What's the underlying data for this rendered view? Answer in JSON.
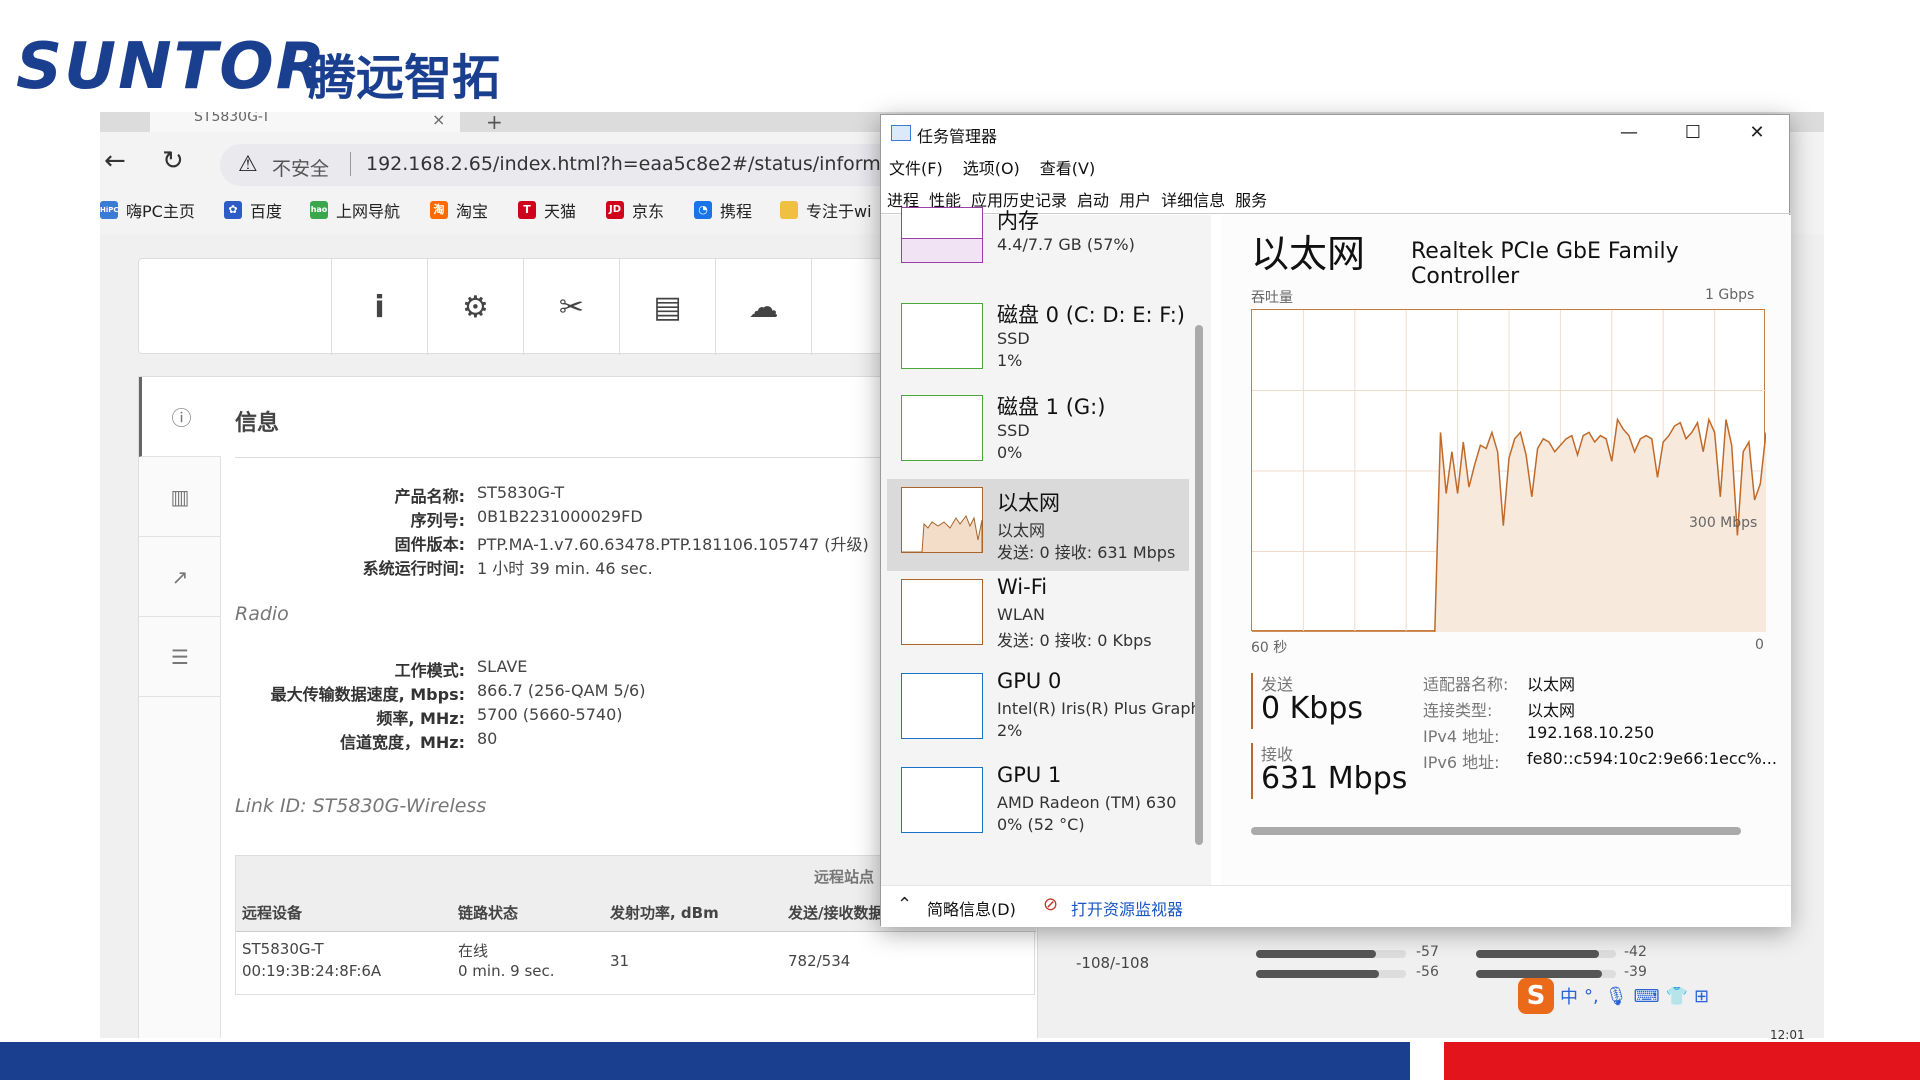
{
  "logo": {
    "latin": "SUNTOR",
    "cn": "腾远智拓"
  },
  "browser": {
    "tab_title": "ST5830G-T",
    "tab_close": "×",
    "new_tab": "+",
    "insecure_label": "不安全",
    "url": "192.168.2.65/index.html?h=eaa5c8e2#/status/information",
    "bookmarks": [
      {
        "icon_text": "HiPC",
        "label": "嗨PC主页",
        "color": "#3a7bd5"
      },
      {
        "icon_text": "",
        "label": "百度",
        "color": "#2d5cc8"
      },
      {
        "icon_text": "hao",
        "label": "上网导航",
        "color": "#3aa84a"
      },
      {
        "icon_text": "淘",
        "label": "淘宝",
        "color": "#ff6a00"
      },
      {
        "icon_text": "T",
        "label": "天猫",
        "color": "#d0021b"
      },
      {
        "icon_text": "JD",
        "label": "京东",
        "color": "#d0021b"
      },
      {
        "icon_text": "",
        "label": "携程",
        "color": "#1a73e8"
      },
      {
        "icon_text": "",
        "label": "专注于wi",
        "color": "#f0c040"
      }
    ]
  },
  "webpage": {
    "info_title": "信息",
    "product": [
      {
        "k": "产品名称:",
        "v": "ST5830G-T"
      },
      {
        "k": "序列号:",
        "v": "0B1B2231000029FD"
      },
      {
        "k": "固件版本:",
        "v": "PTP.MA-1.v7.60.63478.PTP.181106.105747 (升级)"
      },
      {
        "k": "系统运行时间:",
        "v": "1 小时 39 min. 46 sec."
      }
    ],
    "radio_heading": "Radio",
    "radio": [
      {
        "k": "工作模式:",
        "v": "SLAVE"
      },
      {
        "k": "最大传输数据速度, Mbps:",
        "v": "866.7 (256-QAM 5/6)"
      },
      {
        "k": "频率, MHz:",
        "v": "5700 (5660-5740)"
      },
      {
        "k": "信道宽度，MHz:",
        "v": "80"
      }
    ],
    "link_id": "Link ID: ST5830G-Wireless",
    "table": {
      "group_header": "远程站点",
      "headers": [
        "远程设备",
        "链路状态",
        "发射功率, dBm",
        "发送/接收数据"
      ],
      "row": {
        "device": "ST5830G-T",
        "mac": "00:19:3B:24:8F:6A",
        "status": "在线",
        "status_time": "0 min. 9 sec.",
        "tx_power": "31",
        "txrx": "782/534",
        "signal": "-108/-108"
      },
      "bars": [
        {
          "value": -57,
          "label": "-57",
          "fill": 0.8
        },
        {
          "value": -56,
          "label": "-56",
          "fill": 0.82
        },
        {
          "value": -42,
          "label": "-42",
          "fill": 0.88
        },
        {
          "value": -39,
          "label": "-39",
          "fill": 0.9
        }
      ]
    }
  },
  "taskmgr": {
    "title": "任务管理器",
    "menu": [
      "文件(F)",
      "选项(O)",
      "查看(V)"
    ],
    "tabs": [
      "进程",
      "性能",
      "应用历史记录",
      "启动",
      "用户",
      "详细信息",
      "服务"
    ],
    "resources": [
      {
        "name": "内存",
        "l1": "4.4/7.7 GB (57%)",
        "l2": "",
        "color": "#9a3fa8"
      },
      {
        "name": "磁盘 0 (C: D: E: F:)",
        "l1": "SSD",
        "l2": "1%",
        "color": "#4aa83a"
      },
      {
        "name": "磁盘 1 (G:)",
        "l1": "SSD",
        "l2": "0%",
        "color": "#4aa83a"
      },
      {
        "name": "以太网",
        "l1": "以太网",
        "l2": "发送: 0 接收: 631 Mbps",
        "color": "#a8642a"
      },
      {
        "name": "Wi-Fi",
        "l1": "WLAN",
        "l2": "发送: 0 接收: 0 Kbps",
        "color": "#a8642a"
      },
      {
        "name": "GPU 0",
        "l1": "Intel(R) Iris(R) Plus Graph",
        "l2": "2%",
        "color": "#1a73c8"
      },
      {
        "name": "GPU 1",
        "l1": "AMD Radeon (TM) 630",
        "l2": "0% (52 °C)",
        "color": "#1a73c8"
      }
    ],
    "eth_title": "以太网",
    "eth_device": "Realtek PCIe GbE Family Controller",
    "throughput_label": "吞吐量",
    "y_max_label": "1 Gbps",
    "mid_label": "300 Mbps",
    "x_left_label": "60 秒",
    "x_right_label": "0",
    "send_label": "发送",
    "send_value": "0 Kbps",
    "recv_label": "接收",
    "recv_value": "631 Mbps",
    "details": [
      {
        "k": "适配器名称:",
        "v": "以太网"
      },
      {
        "k": "连接类型:",
        "v": "以太网"
      },
      {
        "k": "IPv4 地址:",
        "v": "192.168.10.250"
      },
      {
        "k": "IPv6 地址:",
        "v": "fe80::c594:10c2:9e66:1ecc%..."
      }
    ],
    "footer_brief": "简略信息(D)",
    "footer_monitor": "打开资源监视器"
  },
  "chart_data": {
    "type": "area",
    "title": "",
    "xlabel": "",
    "ylabel": "吞吐量",
    "x_range_label": "60 秒",
    "ylim": [
      0,
      1000
    ],
    "y_unit": "Mbps",
    "series": [
      {
        "values": [
          0,
          0,
          0,
          0,
          0,
          0,
          0,
          0,
          0,
          0,
          0,
          0,
          0,
          0,
          0,
          0,
          0,
          0,
          0,
          0,
          0,
          0,
          0,
          0,
          0,
          0,
          0,
          0,
          0,
          0,
          0,
          0,
          0,
          620,
          430,
          560,
          430,
          590,
          450,
          520,
          580,
          570,
          620,
          560,
          330,
          540,
          600,
          620,
          550,
          420,
          570,
          600,
          590,
          560,
          580,
          600,
          610,
          550,
          610,
          620,
          590,
          610,
          600,
          530,
          660,
          630,
          610,
          560,
          600,
          610,
          600,
          480,
          590,
          610,
          640,
          650,
          600,
          620,
          650,
          560,
          660,
          620,
          420,
          660,
          580,
          300,
          560,
          590,
          410,
          460,
          620
        ]
      }
    ],
    "fill_color": "#f8e9dd",
    "line_color": "#c06a2a",
    "grid": true
  },
  "system": {
    "clock": "12:01"
  }
}
